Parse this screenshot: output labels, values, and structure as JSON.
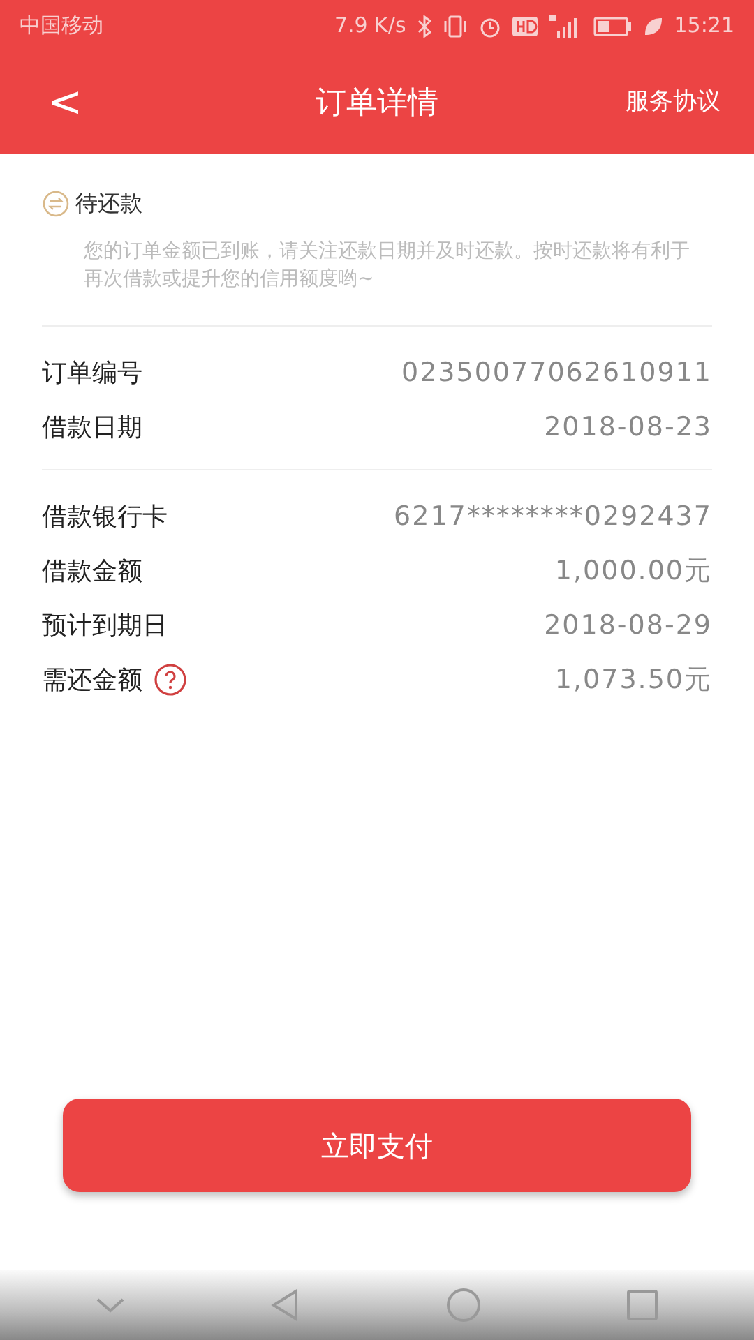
{
  "status_bar": {
    "carrier": "中国移动",
    "speed": "7.9 K/s",
    "time": "15:21"
  },
  "header": {
    "back": "<",
    "title": "订单详情",
    "action": "服务协议"
  },
  "status": {
    "label": "待还款",
    "notice": "您的订单金额已到账，请关注还款日期并及时还款。按时还款将有利于再次借款或提升您的信用额度哟~"
  },
  "sections": [
    [
      {
        "label": "订单编号",
        "value": "02350077062610911",
        "kind": "plain"
      },
      {
        "label": "借款日期",
        "value": "2018-08-23",
        "kind": "plain"
      }
    ],
    [
      {
        "label": "借款银行卡",
        "value": "6217********0292437",
        "kind": "plain"
      },
      {
        "label": "借款金额",
        "value": "1,000.00元",
        "kind": "plain"
      },
      {
        "label": "预计到期日",
        "value": "2018-08-29",
        "kind": "plain"
      },
      {
        "label": "需还金额",
        "value": "1,073.50元",
        "kind": "help"
      }
    ]
  ],
  "pay_button": "立即支付"
}
